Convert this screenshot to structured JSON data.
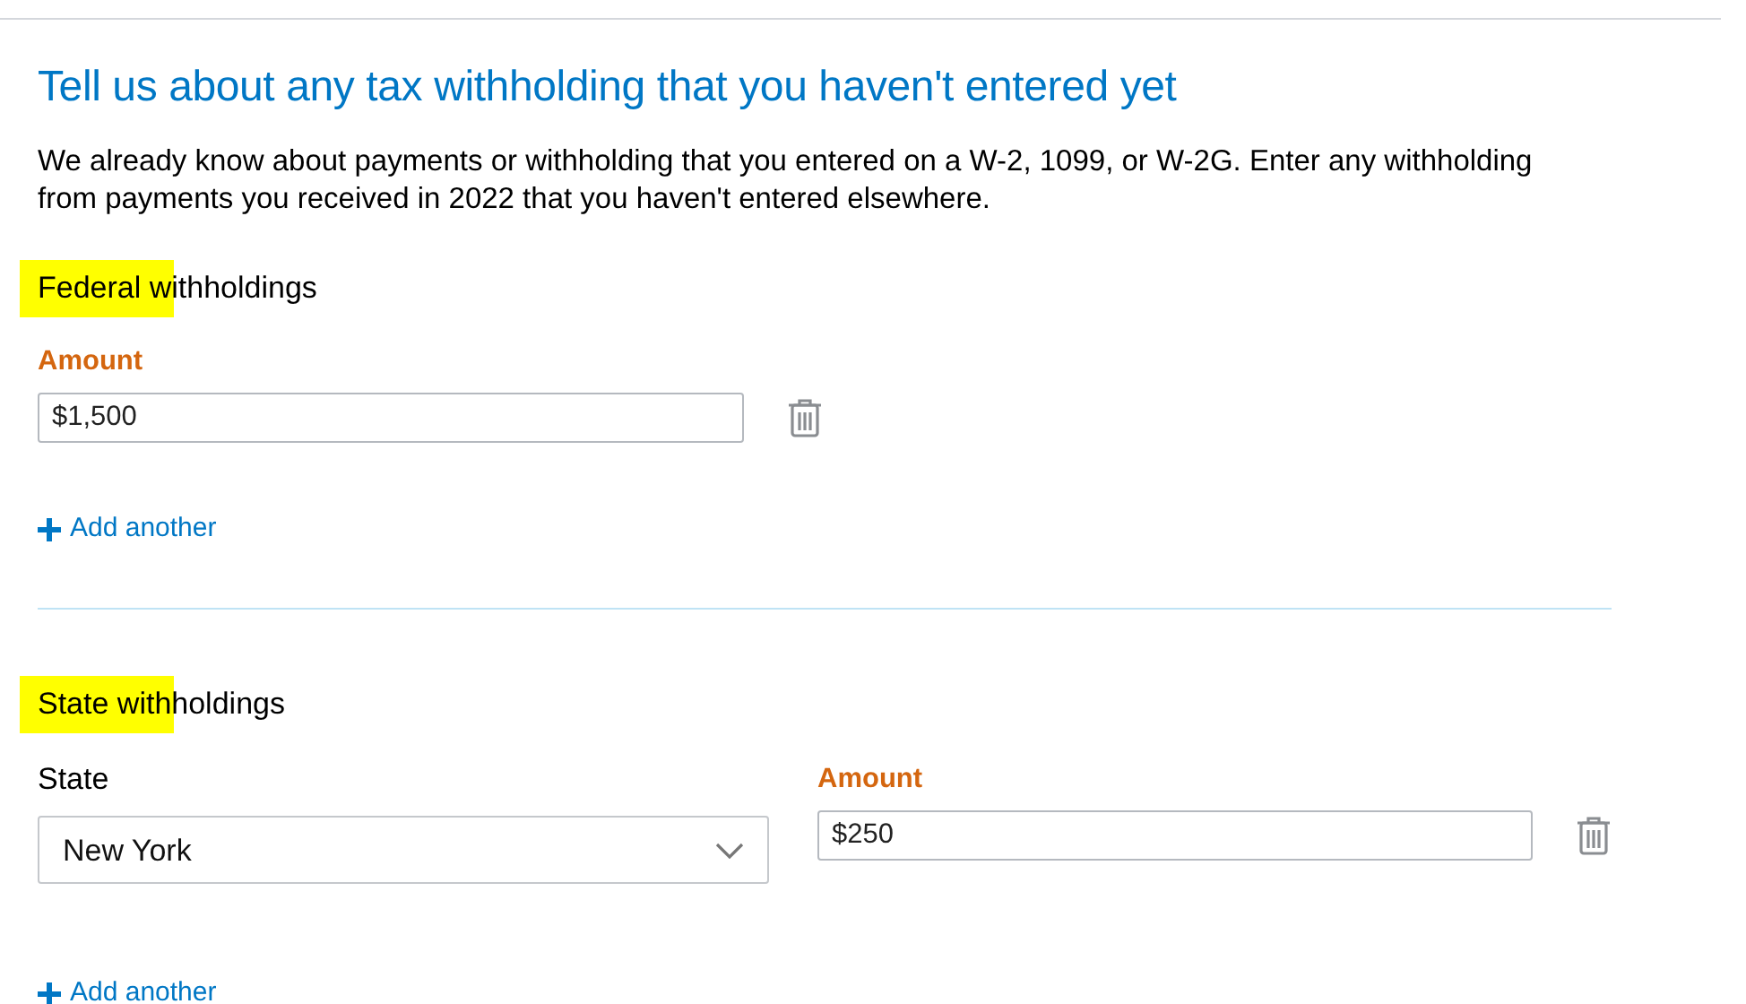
{
  "title": "Tell us about any tax withholding that you haven't entered yet",
  "intro": "We already know about payments or withholding that you entered on a W-2, 1099, or W-2G. Enter any withholding from payments you received in 2022 that you haven't entered elsewhere.",
  "sections": [
    {
      "kind": "amount",
      "heading": "Federal withholdings",
      "highlighted": true,
      "amount_label": "Amount",
      "amount": "$1,500",
      "add_link": "Add another"
    },
    {
      "kind": "state",
      "heading": "State withholdings",
      "highlighted": true,
      "state_label": "State",
      "state": "New York",
      "amount_label": "Amount",
      "amount": "$250",
      "add_link": "Add another"
    }
  ]
}
